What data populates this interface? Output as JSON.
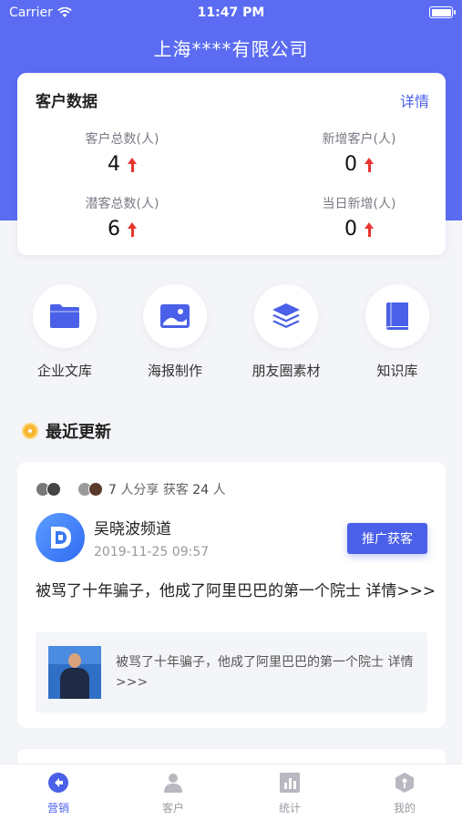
{
  "status_bar": {
    "carrier": "Carrier",
    "time": "11:47 PM"
  },
  "header": {
    "company_title": "上海****有限公司"
  },
  "customer_data": {
    "title": "客户数据",
    "detail_link": "详情",
    "stats": [
      {
        "label": "客户总数(人)",
        "value": "4"
      },
      {
        "label": "新增客户(人)",
        "value": "0"
      },
      {
        "label": "潜客总数(人)",
        "value": "6"
      },
      {
        "label": "当日新增(人)",
        "value": "0"
      }
    ]
  },
  "shortcuts": [
    {
      "label": "企业文库",
      "icon": "folder-icon"
    },
    {
      "label": "海报制作",
      "icon": "image-icon"
    },
    {
      "label": "朋友圈素材",
      "icon": "layers-icon"
    },
    {
      "label": "知识库",
      "icon": "book-icon"
    }
  ],
  "recent": {
    "title": "最近更新",
    "share_count": "7",
    "share_text_1": "人分享 获客",
    "gain_count": "24",
    "share_text_2": "人",
    "channel_name": "吴晓波频道",
    "channel_time": "2019-11-25 09:57",
    "promote_button": "推广获客",
    "article_title": "被骂了十年骗子，他成了阿里巴巴的第一个院士 详情>>>",
    "preview_text": "被骂了十年骗子，他成了阿里巴巴的第一个院士 详情>>>"
  },
  "tabbar": [
    {
      "label": "营销",
      "icon": "marketing-icon",
      "active": true
    },
    {
      "label": "客户",
      "icon": "customer-icon",
      "active": false
    },
    {
      "label": "统计",
      "icon": "stats-icon",
      "active": false
    },
    {
      "label": "我的",
      "icon": "profile-icon",
      "active": false
    }
  ],
  "colors": {
    "primary": "#5b6cf2",
    "accent": "#4a60e8",
    "up_arrow": "#e8352e",
    "clock": "#f7b733"
  }
}
